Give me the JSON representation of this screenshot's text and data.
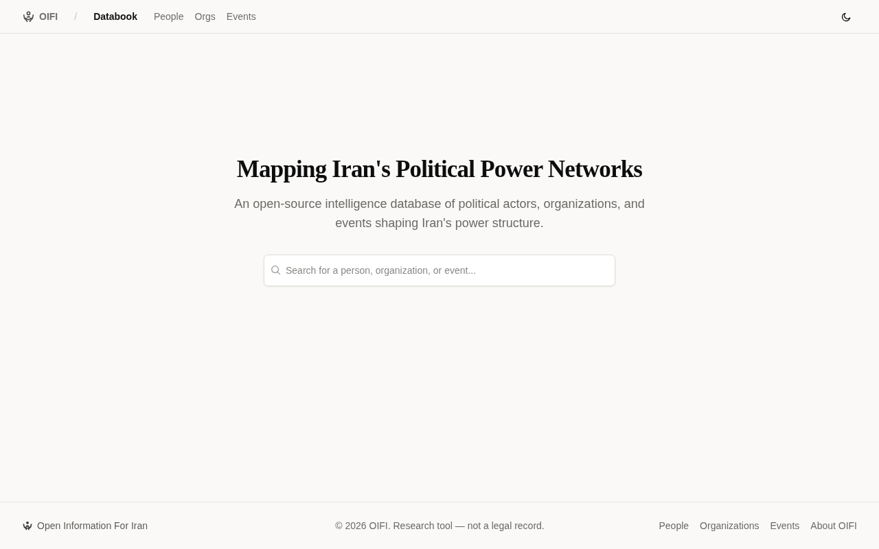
{
  "header": {
    "brand": "OIFI",
    "separator": "/",
    "section": "Databook",
    "nav": [
      {
        "label": "People"
      },
      {
        "label": "Orgs"
      },
      {
        "label": "Events"
      }
    ]
  },
  "hero": {
    "title": "Mapping Iran's Political Power Networks",
    "subtitle": "An open-source intelligence database of political actors, organizations, and events shaping Iran's power structure.",
    "search": {
      "placeholder": "Search for a person, organization, or event..."
    }
  },
  "footer": {
    "brand": "Open Information For Iran",
    "copyright": "© 2026 OIFI. Research tool — not a legal record.",
    "links": [
      {
        "label": "People"
      },
      {
        "label": "Organizations"
      },
      {
        "label": "Events"
      },
      {
        "label": "About OIFI"
      }
    ]
  }
}
